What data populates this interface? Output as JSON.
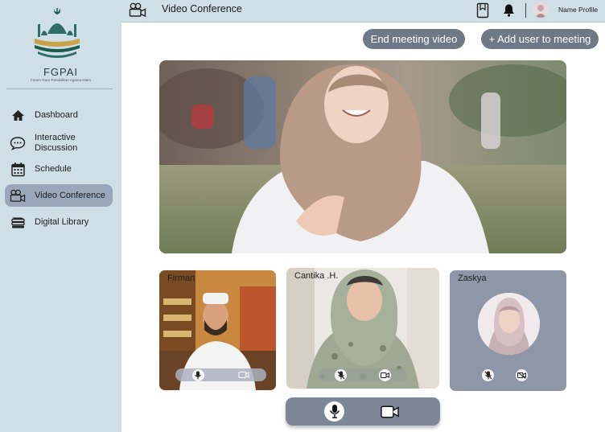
{
  "sidebar": {
    "brand": "FGPAI",
    "brand_subtitle": "Forum Guru Pendidikan Agama Islam",
    "items": [
      {
        "label": "Dashboard",
        "icon": "home-icon"
      },
      {
        "label": "Interactive Discussion",
        "icon": "chat-icon"
      },
      {
        "label": "Schedule",
        "icon": "calendar-icon"
      },
      {
        "label": "Video Conference",
        "icon": "video-conference-icon",
        "active": true
      },
      {
        "label": "Digital Library",
        "icon": "books-icon"
      }
    ]
  },
  "header": {
    "title": "Video Conference",
    "profile_name": "Name Profile"
  },
  "actions": {
    "end_meeting": "End meeting video",
    "add_user": "+ Add user  to meeting"
  },
  "participants": [
    {
      "name": "Firman",
      "mic": "on",
      "camera": "on"
    },
    {
      "name": "Cantika .H.",
      "mic": "muted",
      "camera": "on"
    },
    {
      "name": "Zaskya",
      "mic": "muted",
      "camera": "off"
    }
  ],
  "colors": {
    "sidebar_bg": "#cfdfe6",
    "active_item": "#9aa6ba",
    "button_bg": "#6f7887",
    "tile_bg": "#8e97a8"
  }
}
